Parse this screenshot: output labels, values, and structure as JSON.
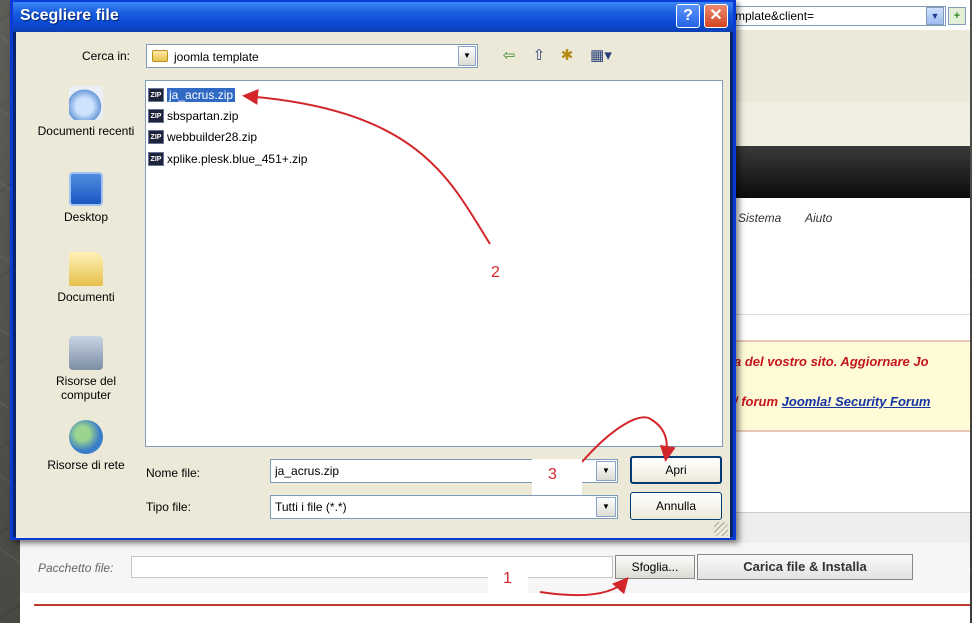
{
  "browser": {
    "address_fragment": "mplate&client=",
    "menu": [
      "Sistema",
      "Aiuto"
    ],
    "warning_line1": "a del vostro sito. Aggiornare Jo",
    "warning_line2_prefix": "/ forum ",
    "warning_link": "Joomla! Security Forum",
    "package_label": "Pacchetto file:",
    "browse_button": "Sfoglia...",
    "upload_button": "Carica file & Installa"
  },
  "dialog": {
    "title": "Scegliere file",
    "help_icon": "?",
    "close_icon": "✕",
    "look_in_label": "Cerca in:",
    "look_in_value": "joomla template",
    "places": [
      "Documenti recenti",
      "Desktop",
      "Documenti",
      "Risorse del computer",
      "Risorse di rete"
    ],
    "files": [
      {
        "name": "ja_acrus.zip",
        "selected": true
      },
      {
        "name": "sbspartan.zip",
        "selected": false
      },
      {
        "name": "webbuilder28.zip",
        "selected": false
      },
      {
        "name": "xplike.plesk.blue_451+.zip",
        "selected": false
      }
    ],
    "file_name_label": "Nome file:",
    "file_name_value": "ja_acrus.zip",
    "file_type_label": "Tipo file:",
    "file_type_value": "Tutti i file (*.*)",
    "open_button": "Apri",
    "cancel_button": "Annulla"
  },
  "annotations": {
    "step1": "1",
    "step2": "2",
    "step3": "3",
    "color": "#d3262b"
  },
  "icons": {
    "zip": "ZIP",
    "back": "⇦",
    "up": "⇧",
    "new_folder": "✱",
    "views": "▦▾",
    "dropdown": "▼"
  }
}
